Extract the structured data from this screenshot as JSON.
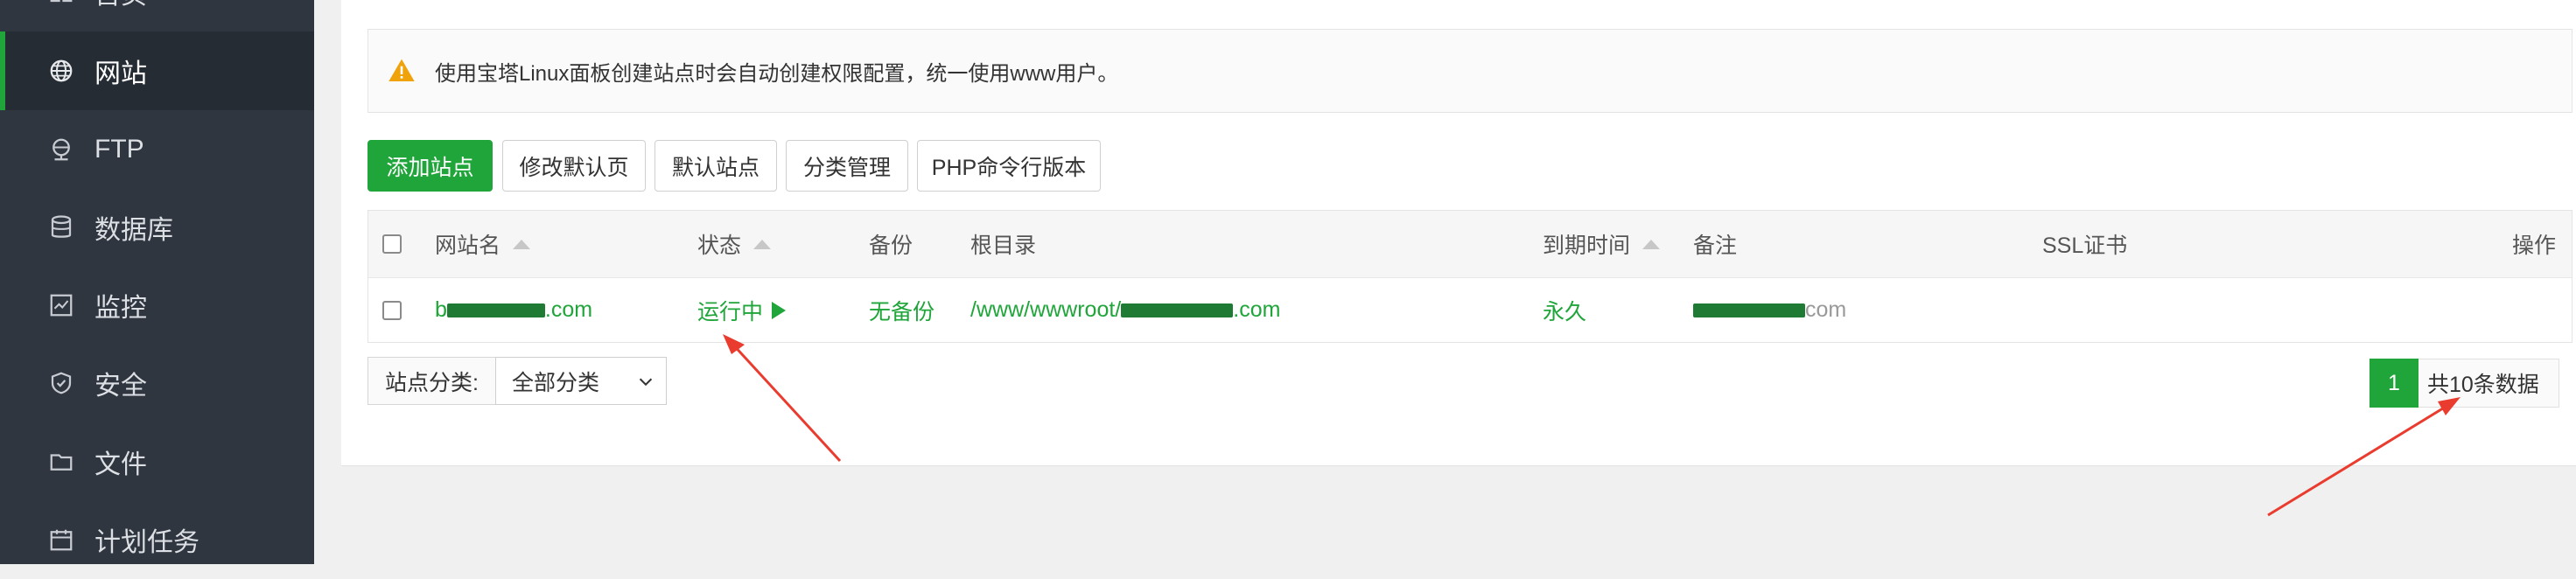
{
  "sidebar": {
    "items": [
      {
        "label": "首页",
        "icon": "home-icon",
        "active": false
      },
      {
        "label": "网站",
        "icon": "globe-icon",
        "active": true
      },
      {
        "label": "FTP",
        "icon": "ftp-icon",
        "active": false
      },
      {
        "label": "数据库",
        "icon": "database-icon",
        "active": false
      },
      {
        "label": "监控",
        "icon": "monitor-icon",
        "active": false
      },
      {
        "label": "安全",
        "icon": "shield-icon",
        "active": false
      },
      {
        "label": "文件",
        "icon": "folder-icon",
        "active": false
      },
      {
        "label": "计划任务",
        "icon": "calendar-icon",
        "active": false
      }
    ]
  },
  "notice": {
    "icon": "warning-icon",
    "text": "使用宝塔Linux面板创建站点时会自动创建权限配置，统一使用www用户。"
  },
  "toolbar": {
    "add_site": "添加站点",
    "edit_default_page": "修改默认页",
    "default_site": "默认站点",
    "category_manage": "分类管理",
    "php_cli_version": "PHP命令行版本"
  },
  "table": {
    "headers": {
      "site_name": "网站名",
      "status": "状态",
      "backup": "备份",
      "root": "根目录",
      "expire": "到期时间",
      "remark": "备注",
      "ssl": "SSL证书",
      "action": "操作"
    },
    "rows": [
      {
        "site_name_prefix": "b",
        "site_name_suffix": ".com",
        "status": "运行中",
        "backup": "无备份",
        "root_prefix": "/www/wwwroot/",
        "root_suffix": ".com",
        "expire": "永久",
        "remark_suffix": "com",
        "ssl": ""
      }
    ]
  },
  "filter": {
    "category_label": "站点分类:",
    "category_value": "全部分类"
  },
  "pagination": {
    "current_page": "1",
    "total_text": "共10条数据"
  },
  "colors": {
    "accent": "#20a53a",
    "sidebar_bg": "#2f3640",
    "annotation_arrow": "#ea3b2f"
  }
}
